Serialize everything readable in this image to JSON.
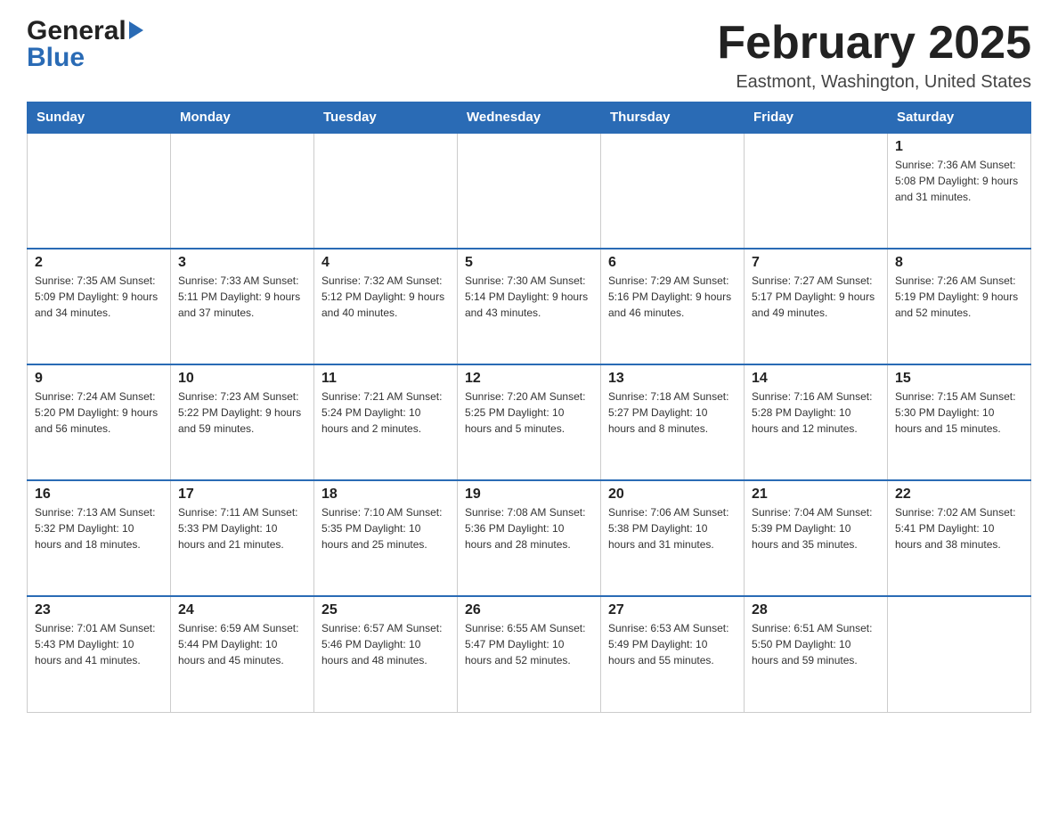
{
  "header": {
    "logo_general": "General",
    "logo_blue": "Blue",
    "month_title": "February 2025",
    "location": "Eastmont, Washington, United States"
  },
  "weekdays": [
    "Sunday",
    "Monday",
    "Tuesday",
    "Wednesday",
    "Thursday",
    "Friday",
    "Saturday"
  ],
  "weeks": [
    [
      {
        "day": "",
        "info": ""
      },
      {
        "day": "",
        "info": ""
      },
      {
        "day": "",
        "info": ""
      },
      {
        "day": "",
        "info": ""
      },
      {
        "day": "",
        "info": ""
      },
      {
        "day": "",
        "info": ""
      },
      {
        "day": "1",
        "info": "Sunrise: 7:36 AM\nSunset: 5:08 PM\nDaylight: 9 hours\nand 31 minutes."
      }
    ],
    [
      {
        "day": "2",
        "info": "Sunrise: 7:35 AM\nSunset: 5:09 PM\nDaylight: 9 hours\nand 34 minutes."
      },
      {
        "day": "3",
        "info": "Sunrise: 7:33 AM\nSunset: 5:11 PM\nDaylight: 9 hours\nand 37 minutes."
      },
      {
        "day": "4",
        "info": "Sunrise: 7:32 AM\nSunset: 5:12 PM\nDaylight: 9 hours\nand 40 minutes."
      },
      {
        "day": "5",
        "info": "Sunrise: 7:30 AM\nSunset: 5:14 PM\nDaylight: 9 hours\nand 43 minutes."
      },
      {
        "day": "6",
        "info": "Sunrise: 7:29 AM\nSunset: 5:16 PM\nDaylight: 9 hours\nand 46 minutes."
      },
      {
        "day": "7",
        "info": "Sunrise: 7:27 AM\nSunset: 5:17 PM\nDaylight: 9 hours\nand 49 minutes."
      },
      {
        "day": "8",
        "info": "Sunrise: 7:26 AM\nSunset: 5:19 PM\nDaylight: 9 hours\nand 52 minutes."
      }
    ],
    [
      {
        "day": "9",
        "info": "Sunrise: 7:24 AM\nSunset: 5:20 PM\nDaylight: 9 hours\nand 56 minutes."
      },
      {
        "day": "10",
        "info": "Sunrise: 7:23 AM\nSunset: 5:22 PM\nDaylight: 9 hours\nand 59 minutes."
      },
      {
        "day": "11",
        "info": "Sunrise: 7:21 AM\nSunset: 5:24 PM\nDaylight: 10 hours\nand 2 minutes."
      },
      {
        "day": "12",
        "info": "Sunrise: 7:20 AM\nSunset: 5:25 PM\nDaylight: 10 hours\nand 5 minutes."
      },
      {
        "day": "13",
        "info": "Sunrise: 7:18 AM\nSunset: 5:27 PM\nDaylight: 10 hours\nand 8 minutes."
      },
      {
        "day": "14",
        "info": "Sunrise: 7:16 AM\nSunset: 5:28 PM\nDaylight: 10 hours\nand 12 minutes."
      },
      {
        "day": "15",
        "info": "Sunrise: 7:15 AM\nSunset: 5:30 PM\nDaylight: 10 hours\nand 15 minutes."
      }
    ],
    [
      {
        "day": "16",
        "info": "Sunrise: 7:13 AM\nSunset: 5:32 PM\nDaylight: 10 hours\nand 18 minutes."
      },
      {
        "day": "17",
        "info": "Sunrise: 7:11 AM\nSunset: 5:33 PM\nDaylight: 10 hours\nand 21 minutes."
      },
      {
        "day": "18",
        "info": "Sunrise: 7:10 AM\nSunset: 5:35 PM\nDaylight: 10 hours\nand 25 minutes."
      },
      {
        "day": "19",
        "info": "Sunrise: 7:08 AM\nSunset: 5:36 PM\nDaylight: 10 hours\nand 28 minutes."
      },
      {
        "day": "20",
        "info": "Sunrise: 7:06 AM\nSunset: 5:38 PM\nDaylight: 10 hours\nand 31 minutes."
      },
      {
        "day": "21",
        "info": "Sunrise: 7:04 AM\nSunset: 5:39 PM\nDaylight: 10 hours\nand 35 minutes."
      },
      {
        "day": "22",
        "info": "Sunrise: 7:02 AM\nSunset: 5:41 PM\nDaylight: 10 hours\nand 38 minutes."
      }
    ],
    [
      {
        "day": "23",
        "info": "Sunrise: 7:01 AM\nSunset: 5:43 PM\nDaylight: 10 hours\nand 41 minutes."
      },
      {
        "day": "24",
        "info": "Sunrise: 6:59 AM\nSunset: 5:44 PM\nDaylight: 10 hours\nand 45 minutes."
      },
      {
        "day": "25",
        "info": "Sunrise: 6:57 AM\nSunset: 5:46 PM\nDaylight: 10 hours\nand 48 minutes."
      },
      {
        "day": "26",
        "info": "Sunrise: 6:55 AM\nSunset: 5:47 PM\nDaylight: 10 hours\nand 52 minutes."
      },
      {
        "day": "27",
        "info": "Sunrise: 6:53 AM\nSunset: 5:49 PM\nDaylight: 10 hours\nand 55 minutes."
      },
      {
        "day": "28",
        "info": "Sunrise: 6:51 AM\nSunset: 5:50 PM\nDaylight: 10 hours\nand 59 minutes."
      },
      {
        "day": "",
        "info": ""
      }
    ]
  ]
}
